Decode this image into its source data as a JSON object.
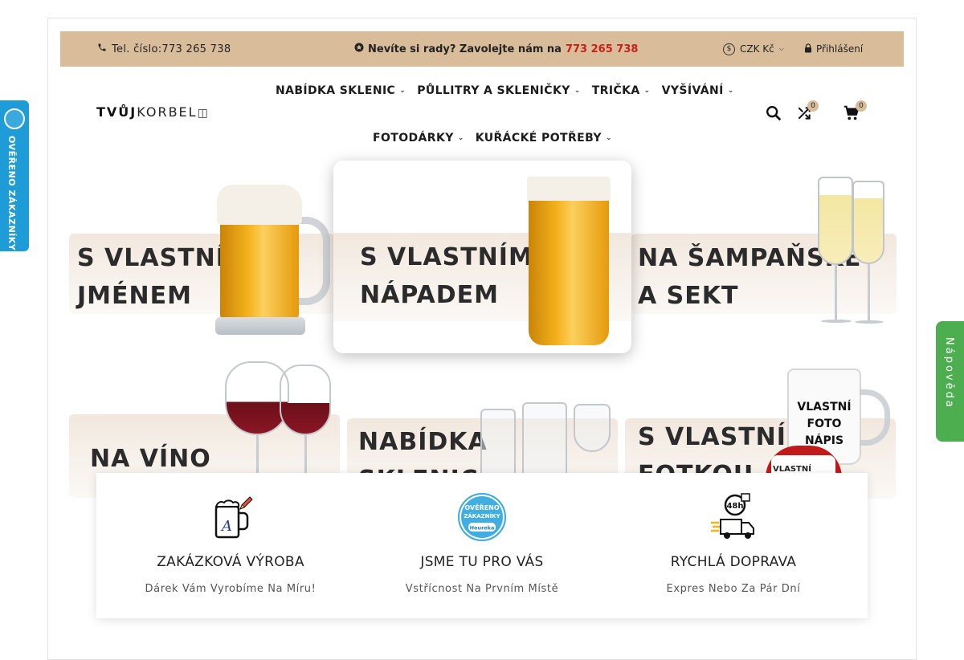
{
  "topbar": {
    "phone_label": "Tel. číslo:773 265 738",
    "help_text": "Nevíte si rady? Zavolejte nám na",
    "help_phone": "773 265 738",
    "currency": "CZK Kč",
    "login": "Přihlášení"
  },
  "header": {
    "logo_bold": "TVŮJ",
    "logo_thin": "KORBEL",
    "nav_row1": [
      "NABÍDKA SKLENIC",
      "PŮLLITRY A SKLENIČKY",
      "TRIČKA",
      "VYŠÍVÁNÍ"
    ],
    "nav_row2": [
      "FOTODÁRKY",
      "KUŘÁCKÉ POTŘEBY"
    ],
    "compare_count": "0",
    "cart_count": "0"
  },
  "banners": [
    {
      "line1": "S VLASTNÍM",
      "line2": "JMÉNEM"
    },
    {
      "line1": "S VLASTNÍM",
      "line2": "NÁPADEM"
    },
    {
      "line1": "NA ŠAMPAŇSKÉ",
      "line2": "A SEKT"
    },
    {
      "line1": "NA VÍNO",
      "line2": ""
    },
    {
      "line1": "NABÍDKA",
      "line2": "SKLENIC"
    },
    {
      "line1": "S VLASTNÍ",
      "line2": "FOTKOU"
    }
  ],
  "photo_mug_text": [
    "VLASTNÍ",
    "FOTO",
    "NÁPIS"
  ],
  "red_mug_text": "VLASTNÍ",
  "features": [
    {
      "title": "ZAKÁZKOVÁ VÝROBA",
      "subtitle": "Dárek Vám Vyrobíme Na Míru!"
    },
    {
      "title": "JSME TU PRO VÁS",
      "subtitle": "Vstřícnost Na Prvním Místě"
    },
    {
      "title": "RYCHLÁ DOPRAVA",
      "subtitle": "Expres Nebo Za Pár Dní"
    }
  ],
  "heureka": {
    "side_label": "OVĚŘENO ZÁKAZNÍKY",
    "badge_line1": "OVĚŘENO",
    "badge_line2": "ZÁKAZNÍKY",
    "badge_brand": "Heureka"
  },
  "delivery_badge": "48h",
  "help_tab": "Nápověda",
  "colors": {
    "topbar_bg": "#d9bd9b",
    "accent_red": "#c8201a",
    "heureka_blue": "#1e9cd7",
    "help_green": "#4cae4f"
  }
}
